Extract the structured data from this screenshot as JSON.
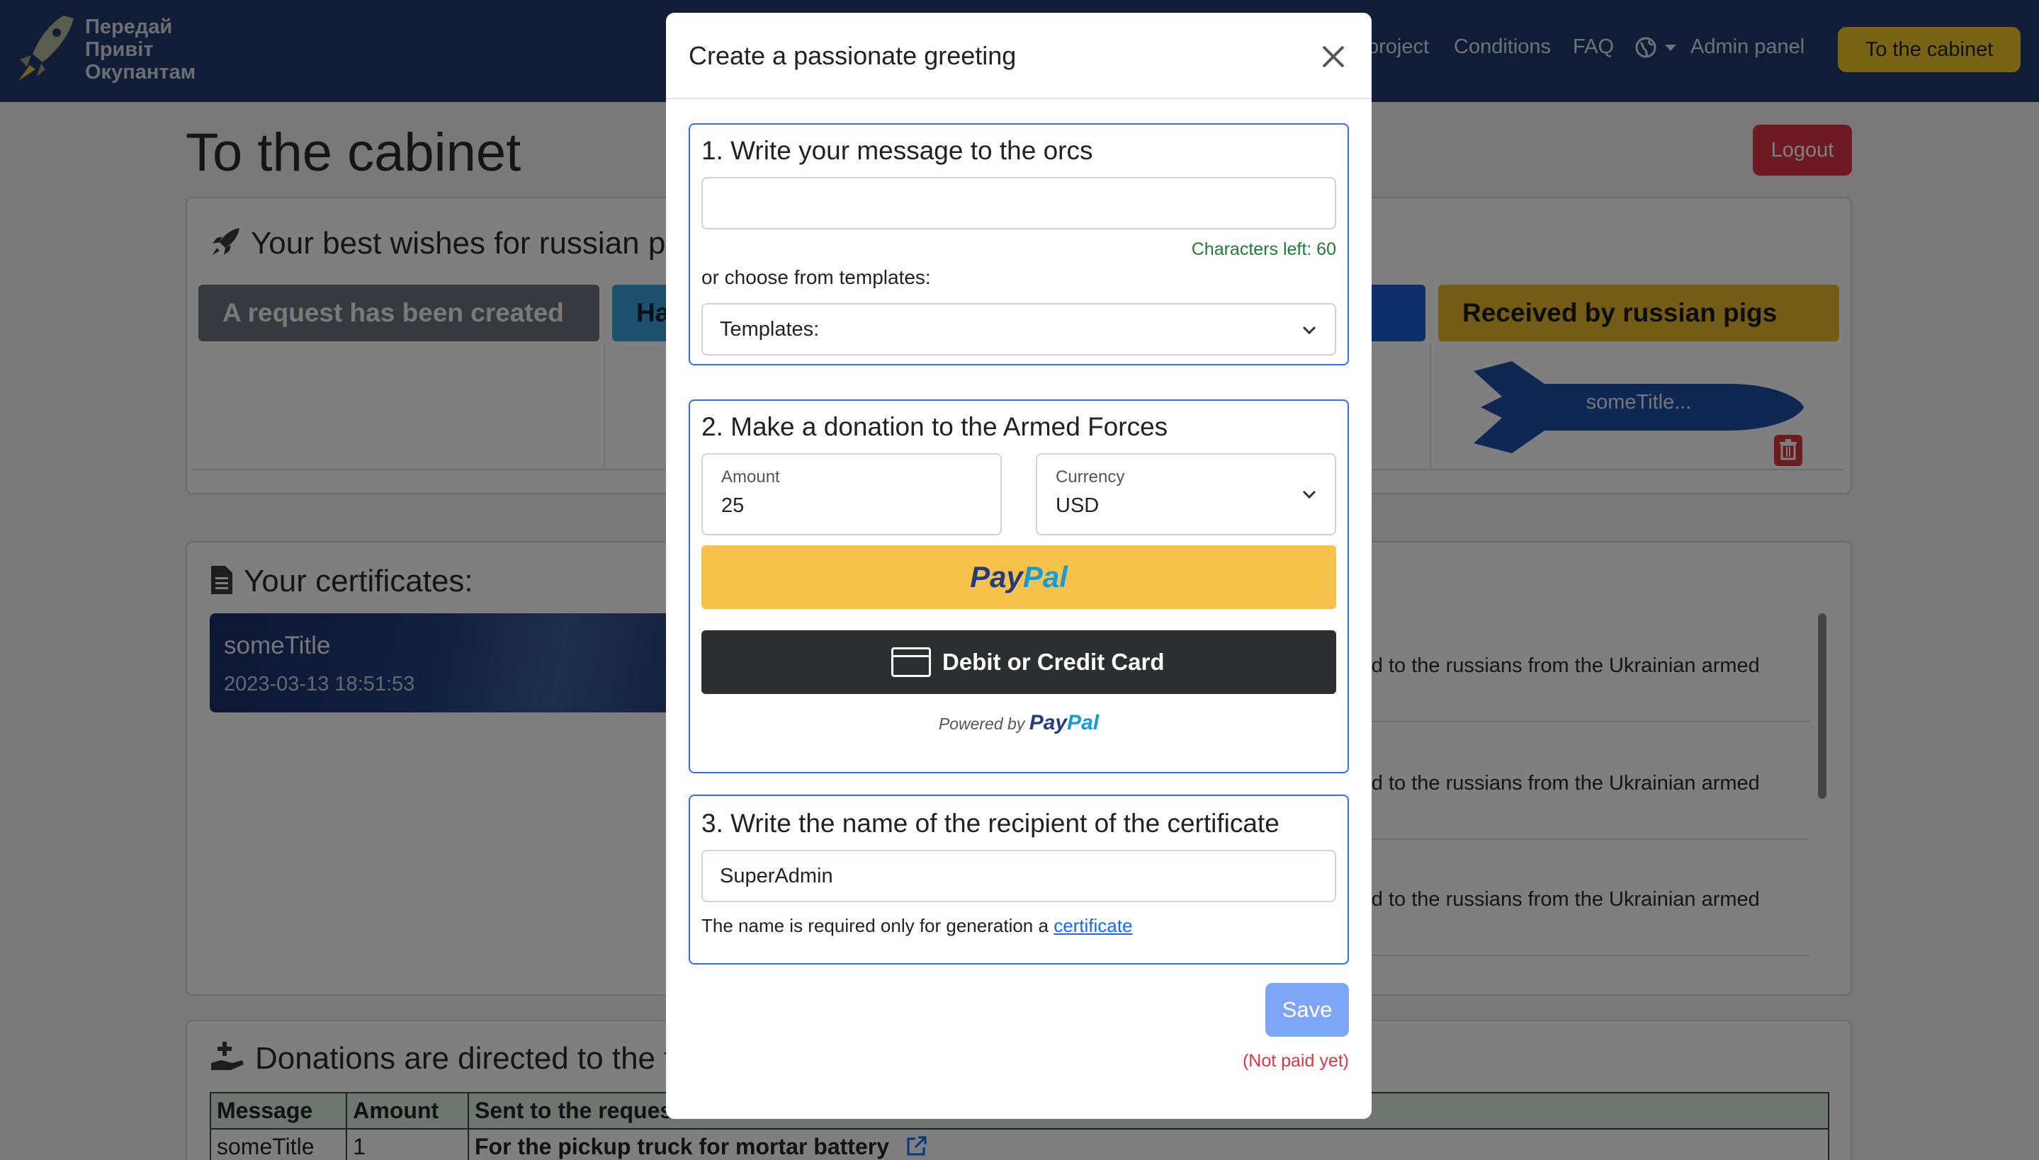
{
  "navbar": {
    "logo_lines": [
      "Передай",
      "Привіт",
      "Окупантам"
    ],
    "links": [
      "project",
      "Conditions",
      "FAQ",
      "Admin panel"
    ],
    "cabinet_button": "To the cabinet"
  },
  "page": {
    "title": "To the cabinet",
    "logout_label": "Logout",
    "wishes_heading": "Your best wishes for russian pi",
    "stages": [
      "A request has been created",
      "Ha",
      "",
      "Received by russian pigs"
    ],
    "rocket_label": "someTitle...",
    "certificates_heading": "Your certificates:",
    "certificate": {
      "title": "someTitle",
      "date": "2023-03-13 18:51:53"
    },
    "list_items": [
      "red to the russians from the Ukrainian armed",
      "red to the russians from the Ukrainian armed",
      "red to the russians from the Ukrainian armed"
    ],
    "donations_heading": "Donations are directed to the f",
    "table": {
      "headers": [
        "Message",
        "Amount",
        "Sent to the request"
      ],
      "rows": [
        [
          "someTitle",
          "1",
          "For the pickup truck for mortar battery"
        ]
      ]
    }
  },
  "modal": {
    "title": "Create a passionate greeting",
    "step1": {
      "title": "1. Write your message to the orcs",
      "message_value": "",
      "chars_left": "Characters left: 60",
      "choose_label": "or choose from templates:",
      "templates_selected": "Templates:"
    },
    "step2": {
      "title": "2. Make a donation to the Armed Forces",
      "amount_label": "Amount",
      "amount_value": "25",
      "currency_label": "Currency",
      "currency_value": "USD",
      "paypal_a": "Pay",
      "paypal_b": "Pal",
      "card_button": "Debit or Credit Card",
      "powered_by": "Powered by",
      "powered_a": "Pay",
      "powered_b": "Pal"
    },
    "step3": {
      "title": "3. Write the name of the recipient of the certificate",
      "name_value": "SuperAdmin",
      "hint": "The name is required only for generation a",
      "hint_link": "certificate"
    },
    "save_label": "Save",
    "status": "(Not paid yet)"
  },
  "colors": {
    "navbar": "#233b6e",
    "accent_yellow": "#f0c929",
    "danger": "#dc3545",
    "primary": "#2f6fe8",
    "paypal_yellow": "#f7c24a"
  }
}
